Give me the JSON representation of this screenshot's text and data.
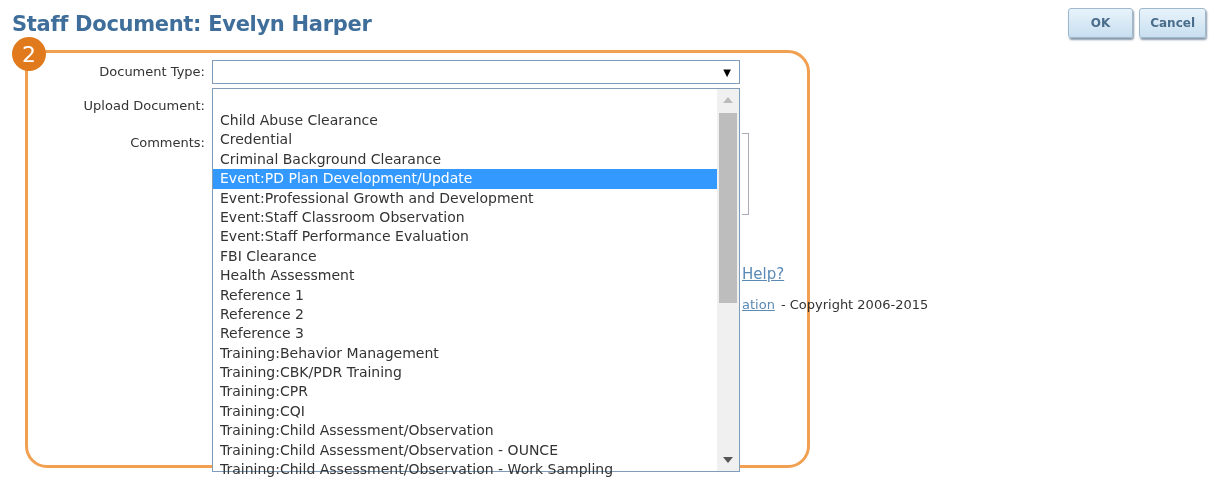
{
  "title": "Staff Document: Evelyn Harper",
  "buttons": [
    {
      "label": "OK"
    },
    {
      "label": "Cancel"
    }
  ],
  "step_badge": "2",
  "form": {
    "labels": [
      "Document Type:",
      "Upload Document:",
      "Comments:"
    ],
    "document_type": {
      "arrow": "▼"
    },
    "options": [
      {
        "label": "Child Abuse Clearance",
        "selected": false
      },
      {
        "label": "Credential",
        "selected": false
      },
      {
        "label": "Criminal Background Clearance",
        "selected": false
      },
      {
        "label": "Event:PD Plan Development/Update",
        "selected": true
      },
      {
        "label": "Event:Professional Growth and Development",
        "selected": false
      },
      {
        "label": "Event:Staff Classroom Observation",
        "selected": false
      },
      {
        "label": "Event:Staff Performance Evaluation",
        "selected": false
      },
      {
        "label": "FBI Clearance",
        "selected": false
      },
      {
        "label": "Health Assessment",
        "selected": false
      },
      {
        "label": "Reference 1",
        "selected": false
      },
      {
        "label": "Reference 2",
        "selected": false
      },
      {
        "label": "Reference 3",
        "selected": false
      },
      {
        "label": "Training:Behavior Management",
        "selected": false
      },
      {
        "label": "Training:CBK/PDR Training",
        "selected": false
      },
      {
        "label": "Training:CPR",
        "selected": false
      },
      {
        "label": "Training:CQI",
        "selected": false
      },
      {
        "label": "Training:Child Assessment/Observation",
        "selected": false
      },
      {
        "label": "Training:Child Assessment/Observation - OUNCE",
        "selected": false
      },
      {
        "label": "Training:Child Assessment/Observation - Work Sampling",
        "selected": false
      }
    ]
  },
  "help_link": "Help?",
  "footer": {
    "link": "ation",
    "text": "- Copyright 2006-2015"
  }
}
